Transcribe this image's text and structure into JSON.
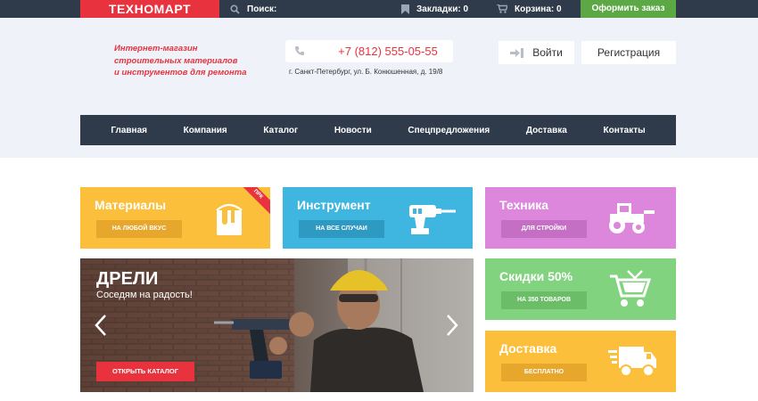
{
  "topbar": {
    "logo": "ТЕХНОМАРТ",
    "search_label": "Поиск:",
    "bookmarks": "Закладки: 0",
    "cart": "Корзина: 0",
    "order_button": "Оформить заказ"
  },
  "header": {
    "slogan": [
      "Интернет-магазин",
      "строительных материалов",
      "и инструментов для ремонта"
    ],
    "phone": "+7 (812) 555-05-55",
    "address": "г. Санкт-Петербург, ул. Б. Конюшенная, д. 19/8",
    "login": "Войти",
    "register": "Регистрация"
  },
  "nav": [
    "Главная",
    "Компания",
    "Каталог",
    "Новости",
    "Спецпредложения",
    "Доставка",
    "Контакты"
  ],
  "tiles": {
    "materials": {
      "title": "Материалы",
      "button": "НА ЛЮБОЙ ВКУС",
      "ribbon": "ПРК"
    },
    "tools": {
      "title": "Инструмент",
      "button": "НА ВСЕ СЛУЧАИ"
    },
    "machinery": {
      "title": "Техника",
      "button": "ДЛЯ СТРОЙКИ"
    },
    "discounts": {
      "title": "Скидки 50%",
      "button": "НА 350 ТОВАРОВ"
    },
    "delivery": {
      "title": "Доставка",
      "button": "БЕСПЛАТНО"
    }
  },
  "slider": {
    "title": "ДРЕЛИ",
    "subtitle": "Соседям на радость!",
    "button": "ОТКРЫТЬ КАТАЛОГ"
  },
  "colors": {
    "dark": "#2f3a4b",
    "red": "#e8323e",
    "green": "#5ba845",
    "yellow": "#fbbf3c",
    "blue": "#3fb6e0",
    "purple": "#dc86dc",
    "light_green": "#82d37f"
  }
}
